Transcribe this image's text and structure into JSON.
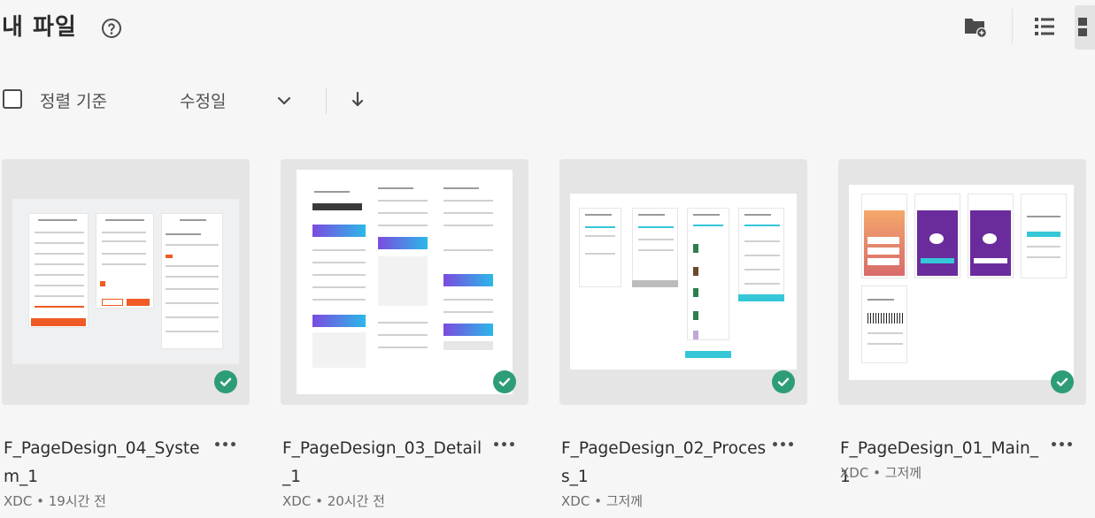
{
  "header": {
    "title": "내 파일",
    "help_icon": "help-circle-icon",
    "new_folder_icon": "folder-add-icon",
    "list_view_icon": "list-view-icon",
    "grid_view_icon": "grid-view-icon"
  },
  "sortbar": {
    "label": "정렬 기준",
    "value": "수정일",
    "chevron_icon": "chevron-down-icon",
    "direction_icon": "arrow-down-icon"
  },
  "files": [
    {
      "name": "F_PageDesign_04_System_1",
      "type": "XDC",
      "modified": "19시간 전",
      "synced": true
    },
    {
      "name": "F_PageDesign_03_Detail_1",
      "type": "XDC",
      "modified": "20시간 전",
      "synced": true
    },
    {
      "name": "F_PageDesign_02_Process_1",
      "type": "XDC",
      "modified": "그저께",
      "synced": true
    },
    {
      "name": "F_PageDesign_01_Main_1",
      "type": "XDC",
      "modified": "그저께",
      "synced": true
    }
  ],
  "colors": {
    "accent_green": "#2d9d78",
    "orange": "#f05a24",
    "teal": "#35c7d8",
    "purple": "#6a2c9c",
    "blue": "#3a6df0"
  }
}
